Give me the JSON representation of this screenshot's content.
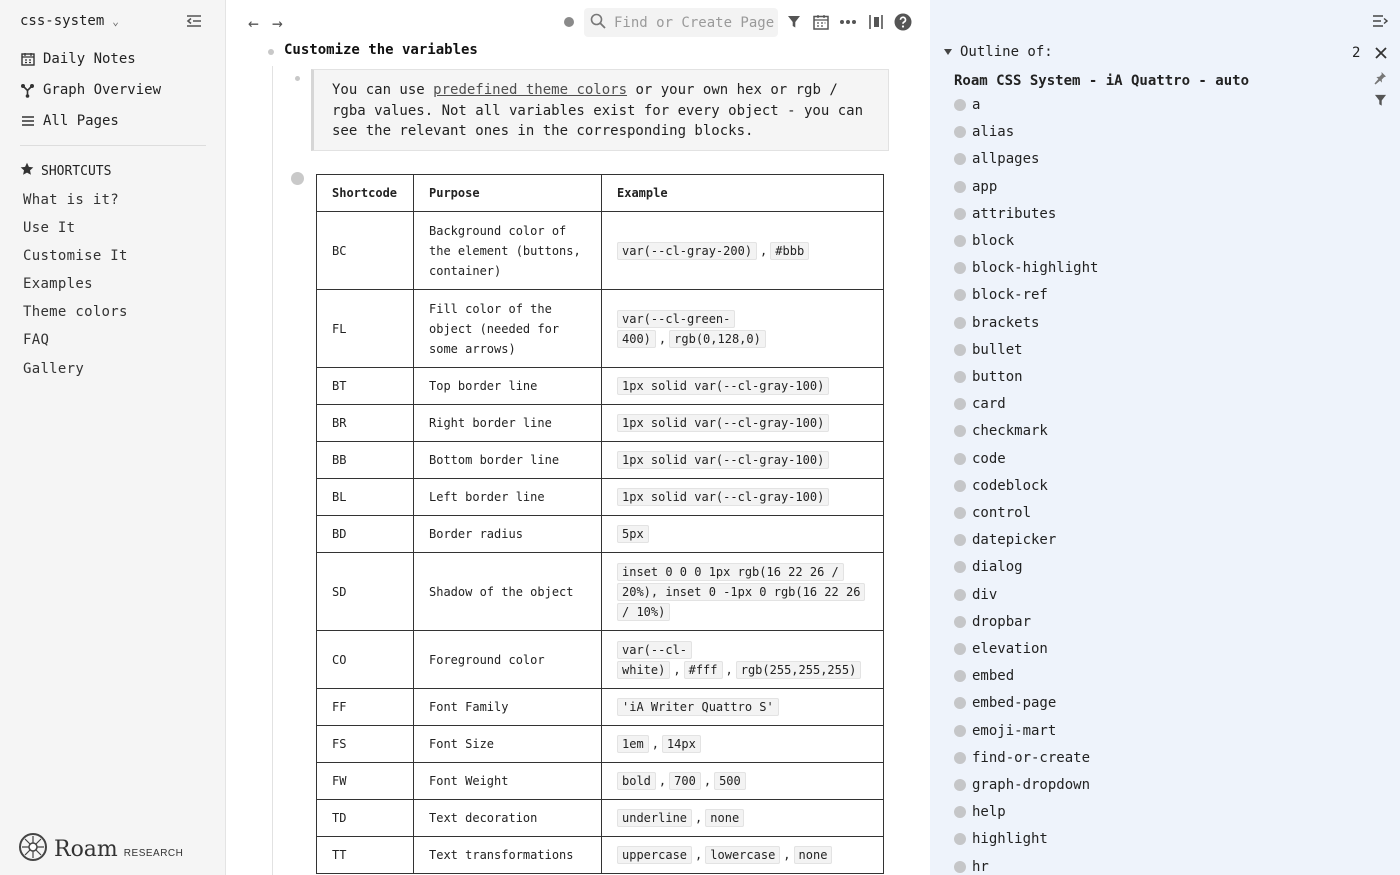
{
  "sidebar": {
    "graph_name": "css-system",
    "nav": [
      {
        "label": "Daily Notes",
        "icon": "calendar-icon"
      },
      {
        "label": "Graph Overview",
        "icon": "graph-icon"
      },
      {
        "label": "All Pages",
        "icon": "list-icon"
      }
    ],
    "shortcuts_title": "SHORTCUTS",
    "shortcuts": [
      "What is it?",
      "Use It",
      "Customise It",
      "Examples",
      "Theme colors",
      "FAQ",
      "Gallery"
    ],
    "logo_word": "Roam",
    "logo_sub": "RESEARCH"
  },
  "topbar": {
    "search_placeholder": "Find or Create Page"
  },
  "main": {
    "heading": "Customize the variables",
    "quote": {
      "pre": "You can use ",
      "link": "predefined theme colors",
      "post": " or your own hex or rgb / rgba values. Not all variables exist for every object - you can see the relevant ones in the corresponding blocks."
    },
    "table": {
      "headers": [
        "Shortcode",
        "Purpose",
        "Example"
      ],
      "rows": [
        {
          "code": "BC",
          "purpose": "Background color of the element (buttons, container)",
          "examples": [
            "var(--cl-gray-200)",
            "#bbb"
          ],
          "h": 78
        },
        {
          "code": "FL",
          "purpose": "Fill color of the object (needed for some arrows)",
          "examples": [
            "var(--cl-green-400)",
            "rgb(0,128,0)"
          ],
          "h": 78
        },
        {
          "code": "BT",
          "purpose": "Top border line",
          "examples": [
            "1px solid var(--cl-gray-100)"
          ],
          "h": 37
        },
        {
          "code": "BR",
          "purpose": "Right border line",
          "examples": [
            "1px solid var(--cl-gray-100)"
          ],
          "h": 37
        },
        {
          "code": "BB",
          "purpose": "Bottom border line",
          "examples": [
            "1px solid var(--cl-gray-100)"
          ],
          "h": 37
        },
        {
          "code": "BL",
          "purpose": "Left border line",
          "examples": [
            "1px solid var(--cl-gray-100)"
          ],
          "h": 37
        },
        {
          "code": "BD",
          "purpose": "Border radius",
          "examples": [
            "5px"
          ],
          "h": 37
        },
        {
          "code": "SD",
          "purpose": "Shadow of the object",
          "examples": [
            "inset 0 0 0 1px rgb(16 22 26 / 20%), inset 0 -1px 0 rgb(16 22 26 / 10%)"
          ],
          "h": 78
        },
        {
          "code": "CO",
          "purpose": "Foreground color",
          "examples": [
            "var(--cl-white)",
            "#fff",
            "rgb(255,255,255)"
          ],
          "h": 58
        },
        {
          "code": "FF",
          "purpose": "Font Family",
          "examples": [
            "'iA Writer Quattro S'"
          ],
          "h": 37
        },
        {
          "code": "FS",
          "purpose": "Font Size",
          "examples": [
            "1em",
            "14px"
          ],
          "h": 37
        },
        {
          "code": "FW",
          "purpose": "Font Weight",
          "examples": [
            "bold",
            "700",
            "500"
          ],
          "h": 37
        },
        {
          "code": "TD",
          "purpose": "Text decoration",
          "examples": [
            "underline",
            "none"
          ],
          "h": 37
        },
        {
          "code": "TT",
          "purpose": "Text transformations",
          "examples": [
            "uppercase",
            "lowercase",
            "none"
          ],
          "h": 37
        }
      ]
    }
  },
  "rightbar": {
    "outline_label": "Outline of:",
    "count": "2",
    "title": "Roam CSS System - iA Quattro - auto",
    "items": [
      "a",
      "alias",
      "allpages",
      "app",
      "attributes",
      "block",
      "block-highlight",
      "block-ref",
      "brackets",
      "bullet",
      "button",
      "card",
      "checkmark",
      "code",
      "codeblock",
      "control",
      "datepicker",
      "dialog",
      "div",
      "dropbar",
      "elevation",
      "embed",
      "embed-page",
      "emoji-mart",
      "find-or-create",
      "graph-dropdown",
      "help",
      "highlight",
      "hr"
    ]
  }
}
